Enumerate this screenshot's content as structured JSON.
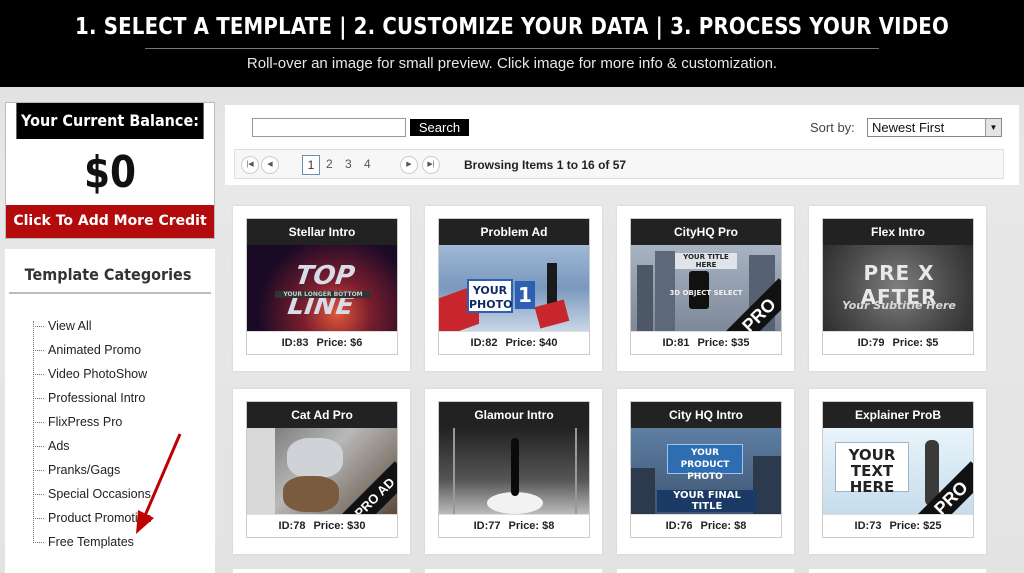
{
  "header": {
    "steps": "1. SELECT A TEMPLATE | 2. CUSTOMIZE YOUR DATA | 3. PROCESS YOUR VIDEO",
    "subtitle": "Roll-over an image for small preview. Click image for more info & customization."
  },
  "balance": {
    "title": "Your Current Balance:",
    "amount": "$0",
    "cta": "Click To Add More Credit"
  },
  "categories": {
    "title": "Template Categories",
    "items": [
      "View All",
      "Animated Promo",
      "Video PhotoShow",
      "Professional Intro",
      "FlixPress Pro",
      "Ads",
      "Pranks/Gags",
      "Special Occasions",
      "Product Promotion",
      "Free Templates"
    ]
  },
  "search": {
    "value": "",
    "button": "Search"
  },
  "sort": {
    "label": "Sort by:",
    "selected": "Newest First"
  },
  "pager": {
    "pages": [
      "1",
      "2",
      "3",
      "4"
    ],
    "current": "1",
    "browsing_prefix": "Browsing Items ",
    "range_start": "1",
    "to": " to ",
    "range_end": "16",
    "of": " of ",
    "total": "57"
  },
  "templates": [
    {
      "title": "Stellar Intro",
      "id": "ID:83",
      "price": "Price: $6",
      "thumb_text": "TOP LINE",
      "thumb_sub": "YOUR LONGER BOTTOM"
    },
    {
      "title": "Problem Ad",
      "id": "ID:82",
      "price": "Price: $40",
      "thumb_text": "YOUR PHOTO",
      "thumb_sub": "1"
    },
    {
      "title": "CityHQ Pro",
      "id": "ID:81",
      "price": "Price: $35",
      "thumb_text": "YOUR TITLE HERE",
      "thumb_sub": "3D OBJECT SELECT",
      "badge": "PRO"
    },
    {
      "title": "Flex Intro",
      "id": "ID:79",
      "price": "Price: $5",
      "thumb_text": "PRE X AFTER",
      "thumb_sub": "Your Subtitle Here"
    },
    {
      "title": "Cat Ad Pro",
      "id": "ID:78",
      "price": "Price: $30",
      "thumb_text": "",
      "thumb_sub": "",
      "badge": "PRO AD"
    },
    {
      "title": "Glamour Intro",
      "id": "ID:77",
      "price": "Price: $8",
      "thumb_text": "",
      "thumb_sub": ""
    },
    {
      "title": "City HQ Intro",
      "id": "ID:76",
      "price": "Price: $8",
      "thumb_text": "YOUR PRODUCT PHOTO",
      "thumb_sub": "YOUR FINAL TITLE"
    },
    {
      "title": "Explainer ProB",
      "id": "ID:73",
      "price": "Price: $25",
      "thumb_text": "YOUR TEXT HERE",
      "thumb_sub": "",
      "badge": "PRO"
    }
  ],
  "colors": {
    "header_bg": "#000000",
    "cta_red": "#b30b0b",
    "arrow_red": "#c00000"
  }
}
